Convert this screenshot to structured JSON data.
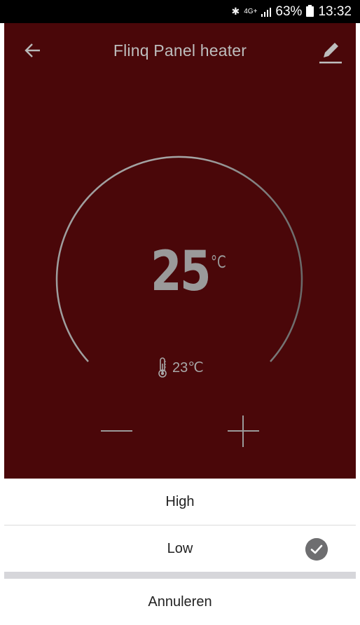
{
  "status_bar": {
    "network": "4G+",
    "battery": "63%",
    "time": "13:32"
  },
  "header": {
    "title": "Flinq Panel heater"
  },
  "thermostat": {
    "setpoint": "25",
    "unit": "°C",
    "current_temperature": "23℃"
  },
  "sheet": {
    "options": [
      "High",
      "Low"
    ],
    "selected": "Low",
    "cancel_label": "Annuleren"
  },
  "colors": {
    "background": "#4a0709",
    "dial_stroke": "#9a9a9a",
    "check_badge": "#6e6e70"
  },
  "icons": {
    "back": "back-arrow-icon",
    "edit": "edit-pencil-icon",
    "thermometer": "thermometer-icon",
    "check": "check-circle-icon"
  }
}
